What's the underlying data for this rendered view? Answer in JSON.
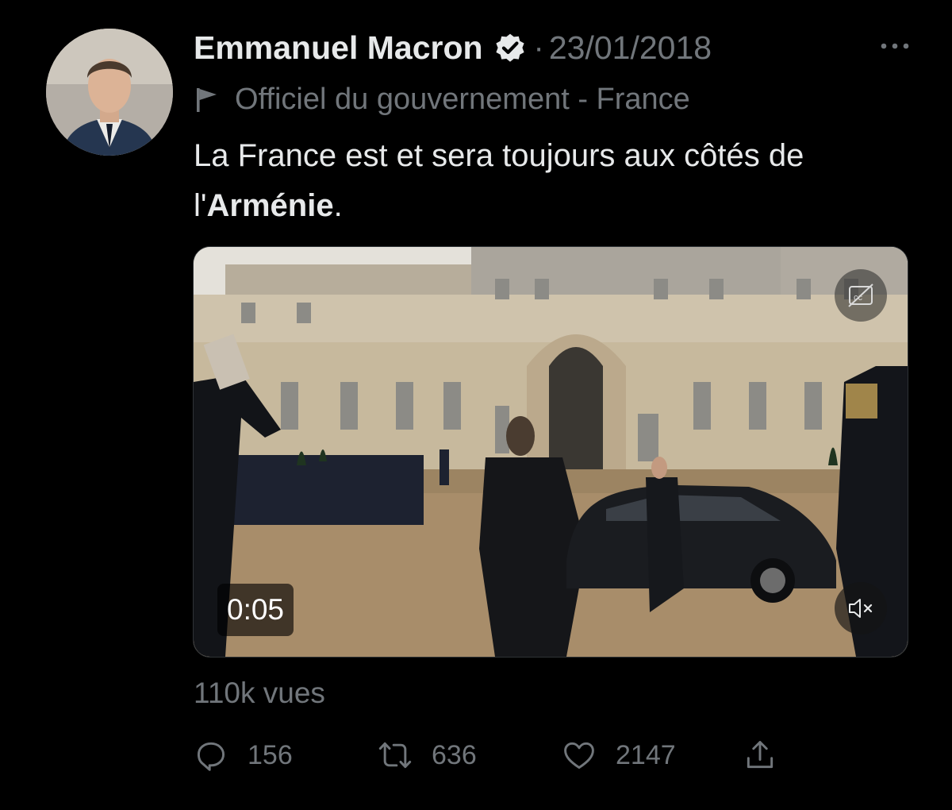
{
  "author": {
    "name": "Emmanuel Macron",
    "date": "23/01/2018",
    "affiliation": "Officiel du gouvernement - France"
  },
  "tweet": {
    "text_prefix": "La France est et sera toujours aux côtés de l'",
    "text_bold": "Arménie",
    "text_suffix": "."
  },
  "video": {
    "duration": "0:05",
    "cc_icon": "closed-captions-off-icon",
    "mute_icon": "speaker-muted-icon"
  },
  "stats": {
    "views": "110k vues",
    "replies": "156",
    "retweets": "636",
    "likes": "2147"
  },
  "colors": {
    "background": "#000000",
    "primary_text": "#e7e9ea",
    "secondary_text": "#71767b"
  }
}
